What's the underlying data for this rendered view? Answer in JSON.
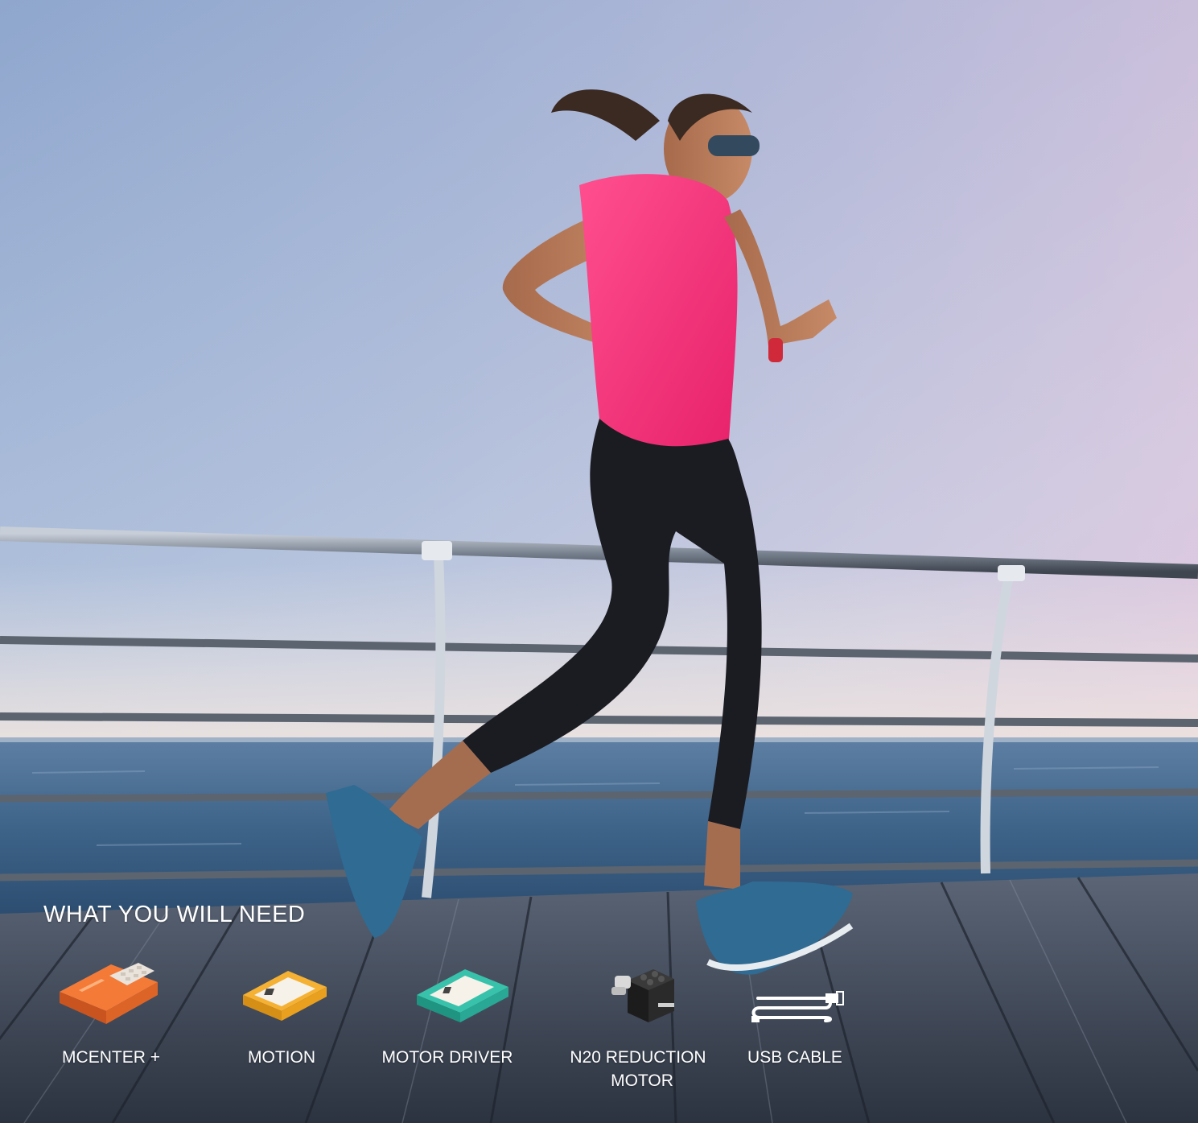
{
  "section": {
    "heading": "WHAT YOU WILL NEED"
  },
  "items": [
    {
      "label": "MCENTER +",
      "icon": "mcenter-module-icon",
      "color": "#e8642a"
    },
    {
      "label": "MOTION",
      "icon": "motion-module-icon",
      "color": "#f2a72a"
    },
    {
      "label": "MOTOR DRIVER",
      "icon": "motor-driver-module-icon",
      "color": "#2bb5a0"
    },
    {
      "label_line1": "N20 REDUCTION",
      "label_line2": "MOTOR",
      "icon": "n20-motor-icon",
      "color": "#2b2b2b"
    },
    {
      "label": "USB CABLE",
      "icon": "usb-cable-icon",
      "color": "#ffffff"
    }
  ]
}
